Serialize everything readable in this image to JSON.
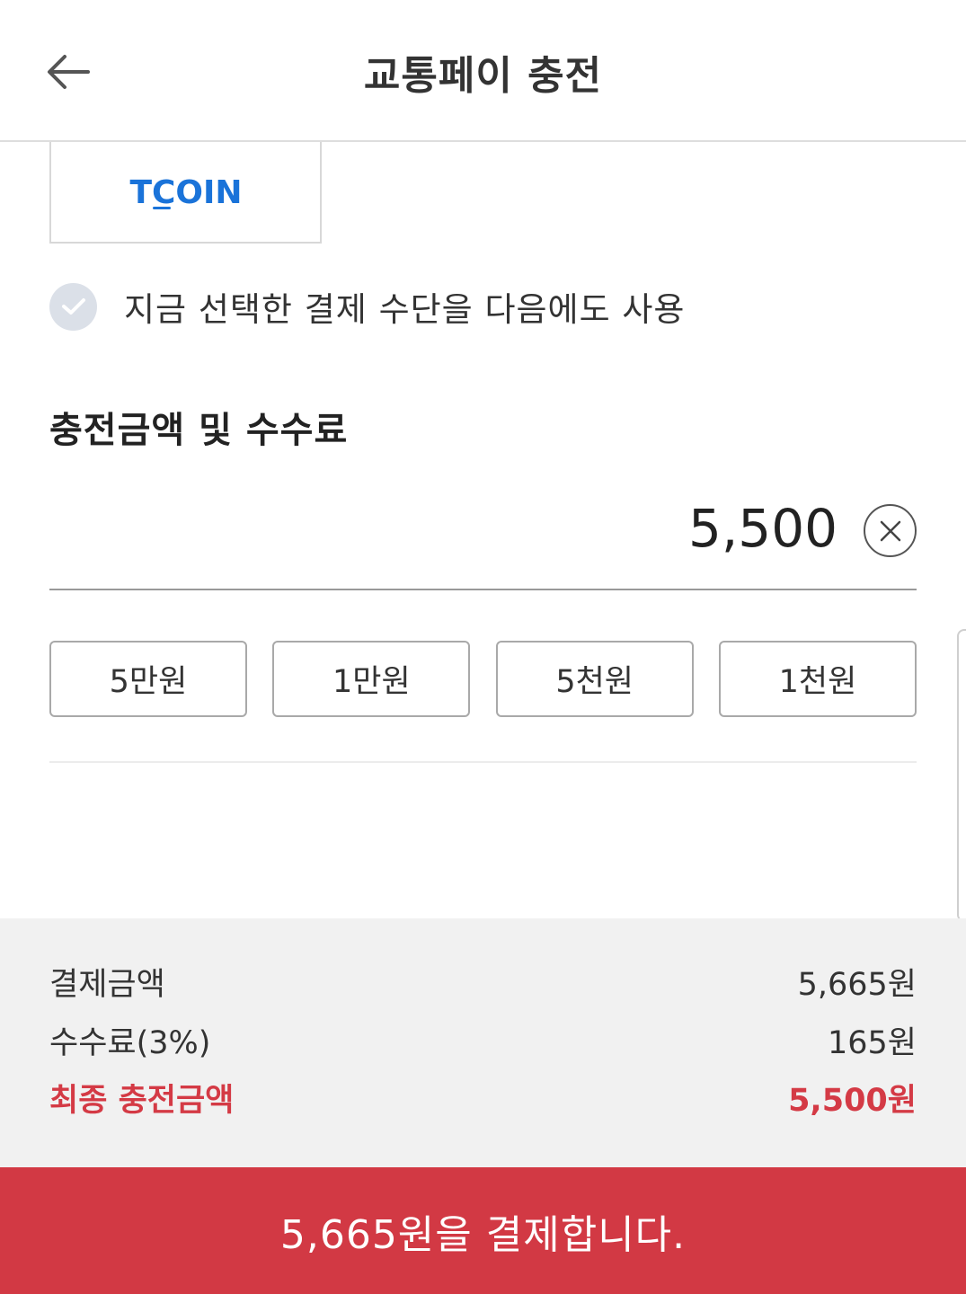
{
  "header": {
    "title": "교통페이 충전",
    "back_icon": "arrow-left-icon"
  },
  "payment_method": {
    "logo_text": "TCOIN",
    "logo_color": "#1a73d9"
  },
  "remember": {
    "label": "지금 선택한 결제 수단을 다음에도 사용",
    "checked": true
  },
  "section": {
    "title": "충전금액 및 수수료"
  },
  "amount": {
    "value": "5,500",
    "clear_icon": "close-circle-icon"
  },
  "quick_amounts": [
    "5만원",
    "1만원",
    "5천원",
    "1천원"
  ],
  "summary": {
    "payment_label": "결제금액",
    "payment_value": "5,665원",
    "fee_label": "수수료(3%)",
    "fee_value": "165원",
    "final_label": "최종 충전금액",
    "final_value": "5,500원"
  },
  "pay_button": {
    "label": "5,665원을 결제합니다."
  },
  "colors": {
    "accent": "#d23944",
    "brand_blue": "#1a73d9",
    "summary_bg": "#f1f1f1"
  }
}
